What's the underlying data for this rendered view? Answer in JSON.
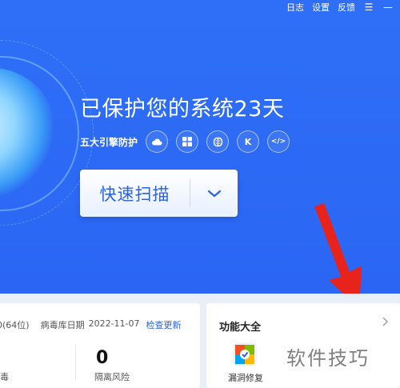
{
  "topbar": {
    "log": "日志",
    "settings": "设置",
    "feedback": "反馈"
  },
  "hero": {
    "title": "已保护您的系统23天",
    "engines_label": "五大引擎防护",
    "engines": [
      {
        "icon": "cloud-icon"
      },
      {
        "icon": "windows-icon"
      },
      {
        "icon": "ai-brain-icon"
      },
      {
        "icon": "kaspersky-k-icon",
        "text": "K"
      },
      {
        "icon": "code-icon",
        "text": "</>"
      }
    ],
    "scan_button": "快速扫描"
  },
  "info": {
    "version_fragment": "0(64位)",
    "db_date_label": "病毒库日期",
    "db_date": "2022-11-07",
    "check_update": "检查更新",
    "quarantine_count": "0",
    "quarantine_label": "隔离风险",
    "left_label_fragment": "毒"
  },
  "features": {
    "title": "功能大全",
    "items": [
      {
        "label": "漏洞修复",
        "icon": "vulnerability-repair-icon"
      }
    ]
  },
  "watermark": "软件技巧",
  "colors": {
    "hero_blue": "#2f6ff7",
    "scan_text": "#2b62e8",
    "link": "#2b62e8",
    "arrow_red": "#e8231c"
  }
}
